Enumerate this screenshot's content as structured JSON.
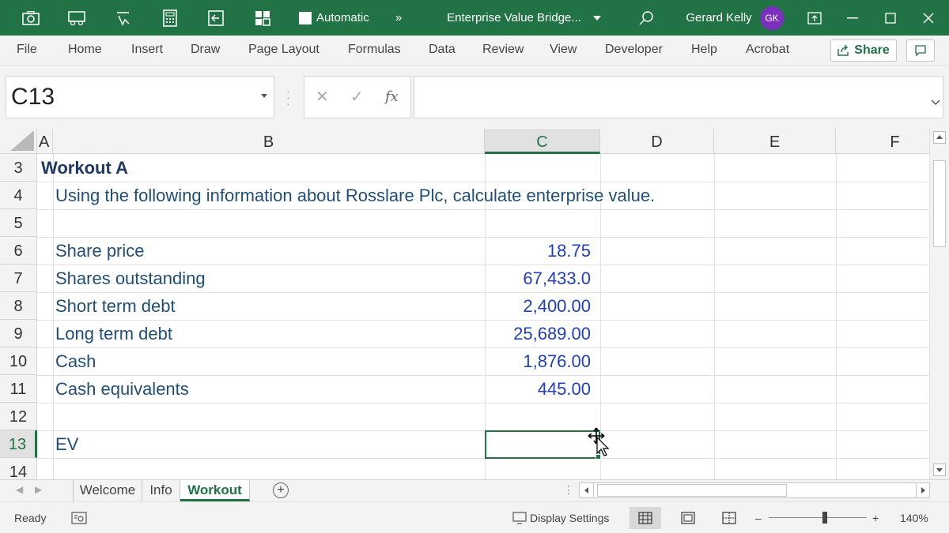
{
  "titlebar": {
    "autosave_label": "Automatic",
    "overflow": "»",
    "doc_title": "Enterprise Value Bridge...",
    "user_name": "Gerard Kelly",
    "user_initials": "GK",
    "icons": [
      "camera-icon",
      "car-icon",
      "touch-icon",
      "calculator-icon",
      "back-arrow-icon",
      "grid-icon",
      "search-icon",
      "ribbon-display-icon",
      "minimize-icon",
      "maximize-icon",
      "close-icon"
    ]
  },
  "ribbon": {
    "tabs": [
      "File",
      "Home",
      "Insert",
      "Draw",
      "Page Layout",
      "Formulas",
      "Data",
      "Review",
      "View",
      "Developer",
      "Help",
      "Acrobat"
    ],
    "share_label": "Share"
  },
  "formula_bar": {
    "name_box": "C13",
    "fx_label": "fx",
    "formula": ""
  },
  "grid": {
    "columns": [
      "A",
      "B",
      "C",
      "D",
      "E",
      "F"
    ],
    "selected_column": "C",
    "rows": [
      "3",
      "4",
      "5",
      "6",
      "7",
      "8",
      "9",
      "10",
      "11",
      "12",
      "13",
      "14"
    ],
    "selected_row": "13",
    "cells": {
      "A3": "Workout A",
      "B4": "Using the following information about Rosslare Plc, calculate enterprise value.",
      "B6": "Share price",
      "C6": "18.75",
      "B7": "Shares outstanding",
      "C7": "67,433.0",
      "B8": "Short term debt",
      "C8": "2,400.00",
      "B9": "Long term debt",
      "C9": "25,689.00",
      "B10": "Cash",
      "C10": "1,876.00",
      "B11": "Cash equivalents",
      "C11": "445.00",
      "B13": "EV"
    },
    "active_cell": "C13"
  },
  "sheets": {
    "tabs": [
      "Welcome",
      "Info",
      "Workout"
    ],
    "active": "Workout",
    "add_label": "+"
  },
  "statusbar": {
    "mode": "Ready",
    "display_settings": "Display Settings",
    "zoom_minus": "–",
    "zoom_plus": "+",
    "zoom": "140%"
  },
  "colors": {
    "accent": "#217346",
    "text_blue": "#1f4e79",
    "number_blue": "#1f3fbf",
    "avatar": "#7b2fbe"
  }
}
